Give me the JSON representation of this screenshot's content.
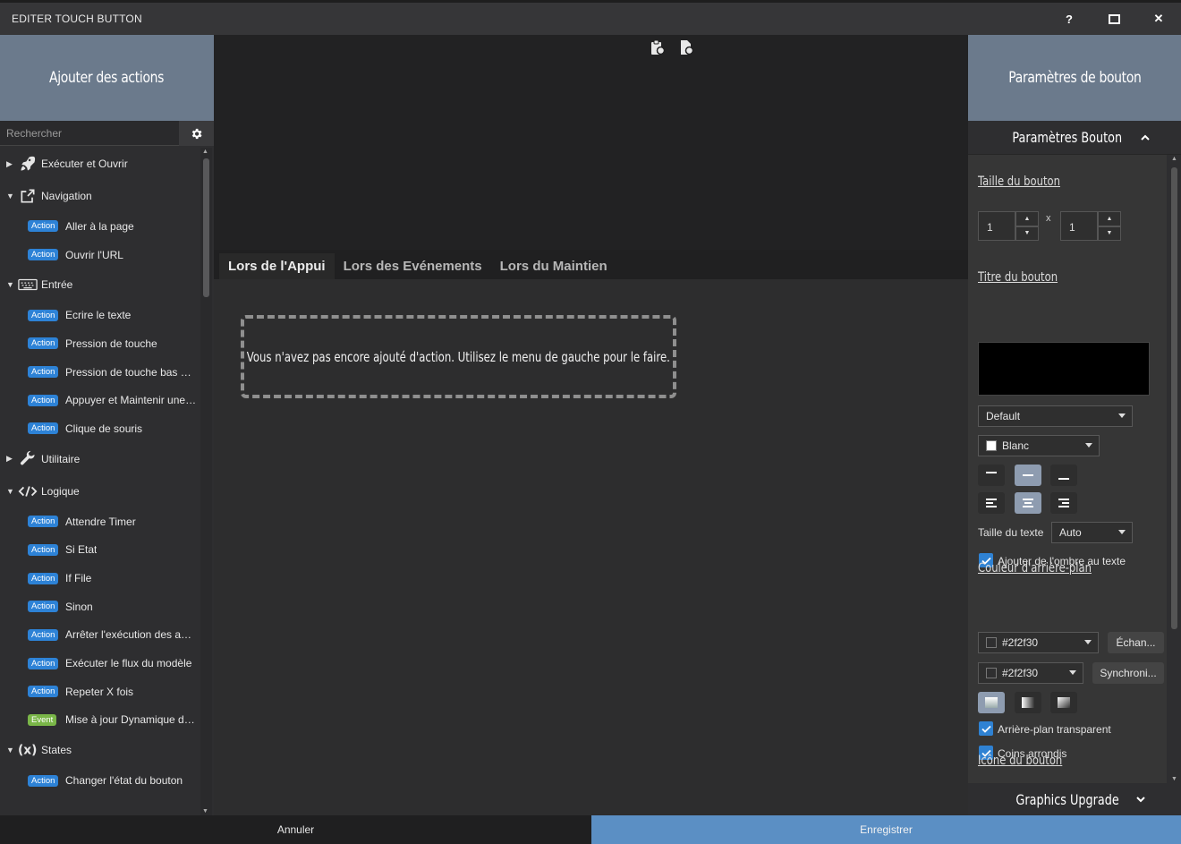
{
  "window": {
    "title": "EDITER TOUCH BUTTON",
    "help": "?",
    "maximize": "□",
    "close": "✕"
  },
  "left": {
    "header": "Ajouter des actions",
    "search_placeholder": "Rechercher",
    "groups": [
      {
        "label": "Exécuter et Ouvrir",
        "expanded": false,
        "icon": "rocket-icon",
        "items": []
      },
      {
        "label": "Navigation",
        "expanded": true,
        "icon": "share-icon",
        "items": [
          {
            "badge": "Action",
            "label": "Aller à la page"
          },
          {
            "badge": "Action",
            "label": "Ouvrir l'URL"
          }
        ]
      },
      {
        "label": "Entrée",
        "expanded": true,
        "icon": "keyboard-icon",
        "items": [
          {
            "badge": "Action",
            "label": "Ecrire le texte"
          },
          {
            "badge": "Action",
            "label": "Pression de touche"
          },
          {
            "badge": "Action",
            "label": "Pression de touche bas niv..."
          },
          {
            "badge": "Action",
            "label": "Appuyer et Maintenir une t..."
          },
          {
            "badge": "Action",
            "label": "Clique de souris"
          }
        ]
      },
      {
        "label": "Utilitaire",
        "expanded": false,
        "icon": "wrench-icon",
        "items": []
      },
      {
        "label": "Logique",
        "expanded": true,
        "icon": "code-icon",
        "items": [
          {
            "badge": "Action",
            "label": "Attendre Timer"
          },
          {
            "badge": "Action",
            "label": "Si Etat"
          },
          {
            "badge": "Action",
            "label": "If File"
          },
          {
            "badge": "Action",
            "label": "Sinon"
          },
          {
            "badge": "Action",
            "label": "Arrêter l'exécution des acti..."
          },
          {
            "badge": "Action",
            "label": "Exécuter le flux du modèle"
          },
          {
            "badge": "Action",
            "label": "Repeter X fois"
          },
          {
            "badge": "Event",
            "label": "Mise à jour Dynamique du ..."
          }
        ]
      },
      {
        "label": "States",
        "expanded": true,
        "icon": "variable-icon",
        "items": [
          {
            "badge": "Action",
            "label": "Changer l'état du bouton"
          }
        ]
      }
    ]
  },
  "center": {
    "tabs": [
      "Lors de l'Appui",
      "Lors des Evénements",
      "Lors du Maintien"
    ],
    "active_tab": 0,
    "empty_message": "Vous n'avez pas encore ajouté d'action. Utilisez le menu de gauche pour le faire."
  },
  "right": {
    "header": "Paramètres de bouton",
    "section": "Paramètres Bouton",
    "size_title": "Taille du bouton",
    "width": "1",
    "height": "1",
    "times": "x",
    "title_title": "Titre du bouton",
    "font_value": "Default",
    "color_value": "Blanc",
    "text_size_label": "Taille du texte",
    "text_size_value": "Auto",
    "shadow_label": "Ajouter de l'ombre au texte",
    "bg_title": "Couleur d'arrière-plan",
    "bg_color1": "#2f2f30",
    "bg_color2": "#2f2f30",
    "swap_label": "Échan...",
    "sync_label": "Synchroni...",
    "transparent_label": "Arrière-plan transparent",
    "rounded_label": "Coins arrondis",
    "icon_title": "Icône du bouton",
    "graphics_section": "Graphics Upgrade"
  },
  "footer": {
    "cancel": "Annuler",
    "save": "Enregistrer"
  },
  "colors": {
    "accent": "#2d82d6",
    "event": "#7ab648",
    "header": "#6b7a8c",
    "save": "#5b8fc4"
  }
}
